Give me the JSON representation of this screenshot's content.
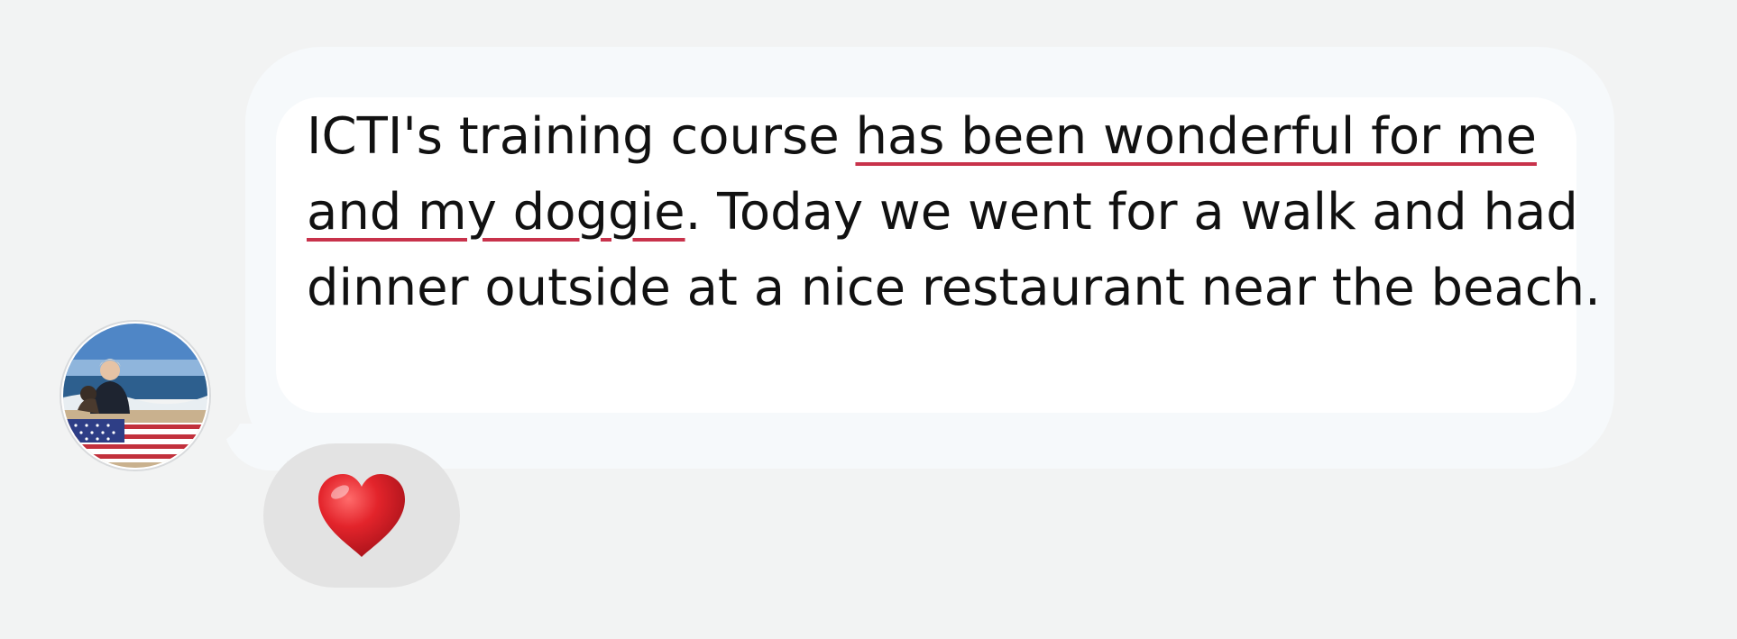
{
  "message": {
    "text_before": "ICTI's training course ",
    "text_underlined": "has been wonderful for me and my doggie",
    "text_after": ". Today we went for a walk and had dinner outside at a nice restaurant near the beach."
  },
  "reaction": {
    "icon": "red-heart-icon",
    "color": "#d61f26"
  },
  "colors": {
    "background": "#f2f3f3",
    "bubble": "#ffffff",
    "underline": "#c8324b"
  }
}
